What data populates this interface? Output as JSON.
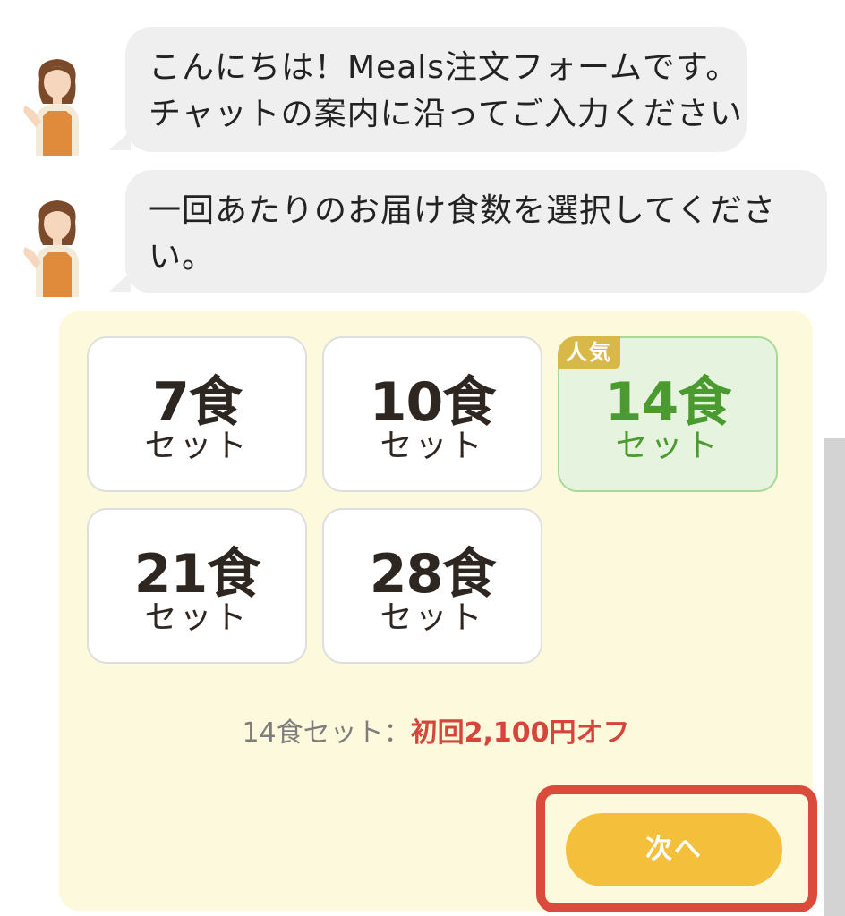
{
  "messages": [
    {
      "lines": [
        "こんにちは！Meals注文フォームです。",
        "チャットの案内に沿ってご入力ください"
      ]
    },
    {
      "lines": [
        "一回あたりのお届け食数を選択してくださ",
        "い。"
      ]
    }
  ],
  "options": [
    {
      "count": "7食",
      "unit": "セット",
      "selected": false
    },
    {
      "count": "10食",
      "unit": "セット",
      "selected": false
    },
    {
      "count": "14食",
      "unit": "セット",
      "selected": true,
      "badge": "人気"
    },
    {
      "count": "21食",
      "unit": "セット",
      "selected": false
    },
    {
      "count": "28食",
      "unit": "セット",
      "selected": false
    }
  ],
  "promo": {
    "label": "14食セット：",
    "value": "初回2,100円オフ"
  },
  "next_button": {
    "label": "次へ"
  },
  "colors": {
    "panel_bg": "#fdf9dc",
    "selected_bg": "#e6f4df",
    "selected_text": "#4a9a2f",
    "badge": "#d9b84a",
    "promo_accent": "#d5453b",
    "button": "#f4c03c",
    "highlight_border": "#db4b3c"
  },
  "icons": {
    "avatar": "staff-woman-avatar-icon"
  }
}
